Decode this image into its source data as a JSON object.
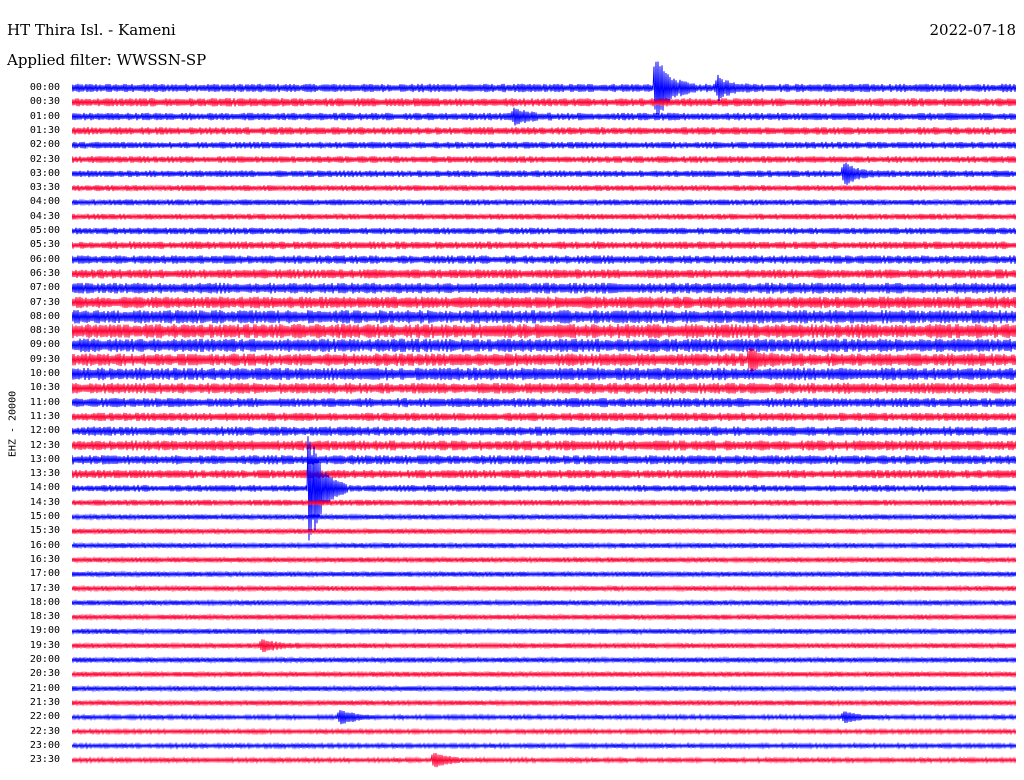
{
  "header": {
    "station": "HT Thira Isl. - Kameni",
    "date": "2022-07-18",
    "filter": "Applied filter: WWSSN-SP"
  },
  "channel_label": "EHZ - 20000",
  "colors": {
    "odd_trace": "#0000ff",
    "even_trace": "#ff0033",
    "background": "#ffffff"
  },
  "chart_data": {
    "type": "line",
    "title": "HT Thira Isl. - Kameni",
    "subtitle": "Applied filter: WWSSN-SP",
    "ylabel": "EHZ - 20000",
    "xlabel": "",
    "rows": [
      "00:00",
      "00:30",
      "01:00",
      "01:30",
      "02:00",
      "02:30",
      "03:00",
      "03:30",
      "04:00",
      "04:30",
      "05:00",
      "05:30",
      "06:00",
      "06:30",
      "07:00",
      "07:30",
      "08:00",
      "08:30",
      "09:00",
      "09:30",
      "10:00",
      "10:30",
      "11:00",
      "11:30",
      "12:00",
      "12:30",
      "13:00",
      "13:30",
      "14:00",
      "14:30",
      "15:00",
      "15:30",
      "16:00",
      "16:30",
      "17:00",
      "17:30",
      "18:00",
      "18:30",
      "19:00",
      "19:30",
      "20:00",
      "20:30",
      "21:00",
      "21:30",
      "22:00",
      "22:30",
      "23:00",
      "23:30"
    ],
    "row_minutes": 30,
    "relative_amplitude": [
      1.0,
      1.0,
      0.9,
      0.9,
      0.8,
      0.8,
      0.8,
      0.7,
      0.7,
      0.7,
      0.8,
      0.9,
      1.0,
      1.1,
      1.3,
      1.4,
      1.6,
      1.7,
      1.6,
      1.5,
      1.5,
      1.3,
      1.1,
      1.0,
      1.1,
      1.2,
      1.1,
      1.0,
      0.8,
      0.7,
      0.6,
      0.6,
      0.6,
      0.6,
      0.6,
      0.6,
      0.6,
      0.6,
      0.6,
      0.6,
      0.6,
      0.6,
      0.6,
      0.6,
      0.5,
      0.5,
      0.5,
      0.5
    ],
    "events": [
      {
        "row": "00:00",
        "minute": 18.5,
        "amplitude": 9.0
      },
      {
        "row": "00:00",
        "minute": 20.5,
        "amplitude": 2.5
      },
      {
        "row": "01:00",
        "minute": 14.0,
        "amplitude": 1.8
      },
      {
        "row": "03:00",
        "minute": 24.5,
        "amplitude": 2.5
      },
      {
        "row": "09:30",
        "minute": 21.5,
        "amplitude": 2.0
      },
      {
        "row": "14:00",
        "minute": 7.5,
        "amplitude": 16.0
      },
      {
        "row": "19:30",
        "minute": 6.0,
        "amplitude": 1.5
      },
      {
        "row": "22:00",
        "minute": 8.5,
        "amplitude": 2.0
      },
      {
        "row": "22:00",
        "minute": 24.5,
        "amplitude": 1.5
      },
      {
        "row": "23:30",
        "minute": 11.5,
        "amplitude": 2.0
      }
    ],
    "grid": false,
    "legend": "none"
  }
}
